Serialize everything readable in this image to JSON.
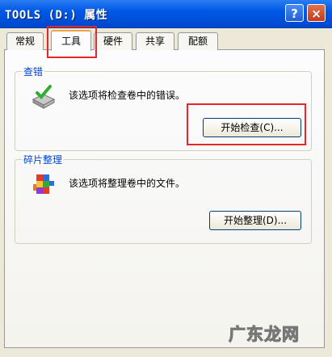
{
  "window": {
    "title": "TOOLS (D:) 属性",
    "help_button": "?",
    "close_button": "×"
  },
  "tabs": [
    {
      "label": "常规",
      "active": false
    },
    {
      "label": "工具",
      "active": true
    },
    {
      "label": "硬件",
      "active": false
    },
    {
      "label": "共享",
      "active": false
    },
    {
      "label": "配额",
      "active": false
    }
  ],
  "error_check": {
    "title": "查错",
    "description": "该选项将检查卷中的错误。",
    "button_label": "开始检查(C)..."
  },
  "defrag": {
    "title": "碎片整理",
    "description": "该选项将整理卷中的文件。",
    "button_label": "开始整理(D)..."
  },
  "watermark": "广东龙网",
  "colors": {
    "title_bar": "#0054e3",
    "highlight": "#e8262a",
    "group_title": "#0046d5"
  }
}
